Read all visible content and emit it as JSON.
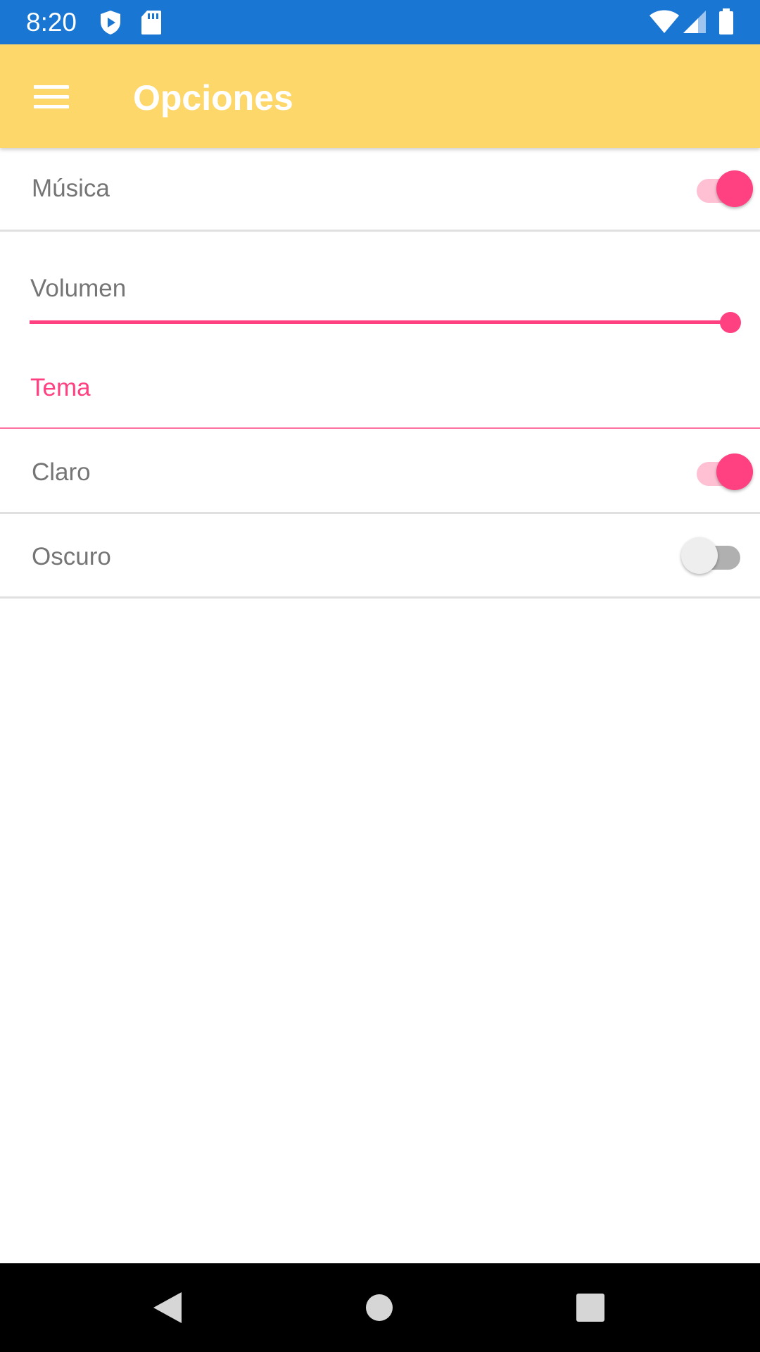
{
  "status_bar": {
    "time": "8:20",
    "left_icons": [
      "shield-play-icon",
      "sd-card-icon"
    ],
    "right_icons": [
      "wifi-icon",
      "cell-signal-icon",
      "battery-icon"
    ],
    "background_color": "#1976d2"
  },
  "app_bar": {
    "title": "Opciones",
    "menu_icon": "menu-icon",
    "background_color": "#fed76a"
  },
  "settings": {
    "music": {
      "label": "Música",
      "checked": true
    },
    "volume": {
      "label": "Volumen",
      "value": 1.0
    },
    "theme": {
      "header": "Tema",
      "options": [
        {
          "label": "Claro",
          "checked": true
        },
        {
          "label": "Oscuro",
          "checked": false
        }
      ]
    }
  },
  "nav_bar": {
    "buttons": [
      "back-icon",
      "home-icon",
      "recents-icon"
    ]
  },
  "colors": {
    "accent": "#ff4081",
    "accent_light": "#ffc0d3",
    "text_secondary": "#757575"
  }
}
